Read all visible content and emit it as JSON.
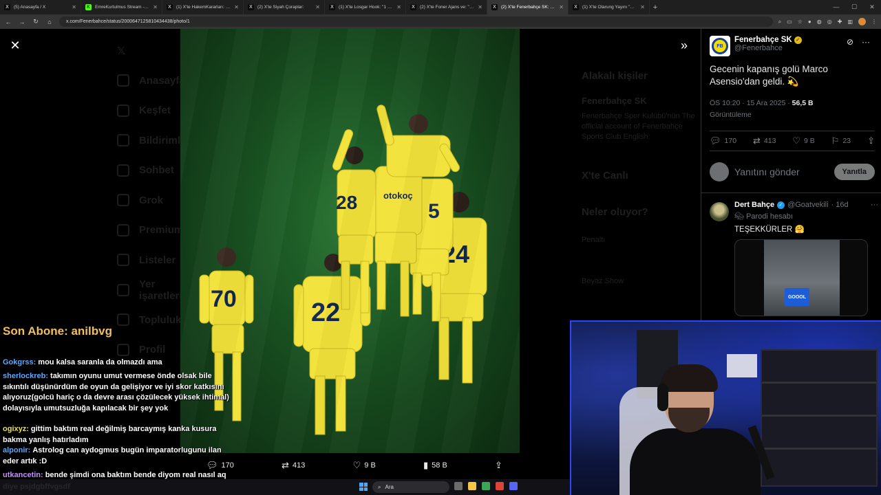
{
  "browser": {
    "tabs": [
      {
        "title": "(5) Anasayfa / X",
        "icon": "x-logo",
        "active": false
      },
      {
        "title": "EmreKurtulmus Stream - Watch",
        "icon": "kick-logo",
        "active": false
      },
      {
        "title": "(1) X'te HakemKararları: \"Ozan",
        "icon": "x-logo",
        "active": false
      },
      {
        "title": "(2) X'te Siyah Çoraplar:",
        "icon": "x-logo",
        "active": false
      },
      {
        "title": "(1) X'te Losgar Hook: \"1 haftalık",
        "icon": "x-logo",
        "active": false
      },
      {
        "title": "(2) X'te Foner Ajans ve: \"SON D",
        "icon": "x-logo",
        "active": false
      },
      {
        "title": "(2) X'te Fenerbahçe SK: \"Gecen",
        "icon": "x-logo",
        "active": true
      },
      {
        "title": "(1) X'te Olarung Yayını \"Yağız Sa",
        "icon": "x-logo",
        "active": false
      }
    ],
    "url": "x.com/Fenerbahce/status/2000647125810434438/photo/1"
  },
  "x_sidebar_dimmed": [
    "Anasayfa",
    "Keşfet",
    "Bildirimler",
    "Sohbet",
    "Grok",
    "Premium",
    "Listeler",
    "Yer işaretleri",
    "Topluluklar",
    "Profil"
  ],
  "x_right_dimmed": {
    "related_title": "Alakalı kişiler",
    "related_name": "Fenerbahçe SK",
    "related_bio": "Fenerbahçe Spor Kulübü'nün The official account of Fenerbahçe Sports Club English:",
    "live_title": "X'te Canlı",
    "trending_title": "Neler oluyor?",
    "trend_1": "Penaltı",
    "trend_2": "Beyaz Show"
  },
  "photo_actions": {
    "replies": "170",
    "reposts": "413",
    "likes": "9 B",
    "views": "58 B"
  },
  "tweet": {
    "name": "Fenerbahçe SK",
    "handle": "@Fenerbahce",
    "text": "Gecenin kapanış golü Marco Asensio'dan geldi. 💫",
    "time": "ÖS 10:20 · 15 Ara 2025 ·",
    "views": "56,5 B",
    "views_label": "Görüntüleme",
    "stats": {
      "replies": "170",
      "reposts": "413",
      "likes": "9 B",
      "bookmarks": "23"
    },
    "reply_placeholder": "Yanıtını gönder",
    "reply_button": "Yanıtla"
  },
  "reply_post": {
    "name": "Dert Bahçe",
    "handle": "@Goatvekili",
    "age": "· 16d",
    "label": "Parodi hesabı",
    "text": "TEŞEKKÜRLER 🤗",
    "media_text": "GOOOL"
  },
  "overlay": {
    "last_sub": "Son Abone: anilbvg",
    "chat": [
      {
        "user": "Gokgrss:",
        "color": "#5ea8ff",
        "text": "mou kalsa saranla da olmazdı ama"
      },
      {
        "user": "sherlockreb:",
        "color": "#5ea8ff",
        "text": "takımın oyunu umut vermese önde olsak bile sıkıntılı düşünürdüm de oyun da gelişiyor ve iyi skor katkısını alıyoruz(golcü hariç o da devre arası çözülecek yüksek ihtimal) dolayısıyla umutsuzluğa kapılacak bir şey yok"
      },
      {
        "user": "ogixyz:",
        "color": "#e8e05a",
        "text": "gittim baktım real değilmiş barcaymış kanka kusura bakma yanlış hatırladım"
      },
      {
        "user": "alponir:",
        "color": "#5ea8ff",
        "text": "Astrolog can aydogmus bugün imparatorlugunu ilan eder artık :D"
      },
      {
        "user": "utkancetin:",
        "color": "#c58cff",
        "text": "bende şimdi ona baktım bende diyom real nasıl aq"
      },
      {
        "user": "",
        "color": "#ffffff",
        "text": "diye psjdgbffvgsdf"
      }
    ]
  },
  "taskbar": {
    "search_placeholder": "Ara"
  },
  "colors": {
    "fb_yellow": "#f5dc00",
    "fb_navy": "#163f8c",
    "x_blue": "#1d9bf0",
    "pitch_green": "#1b5a24"
  }
}
